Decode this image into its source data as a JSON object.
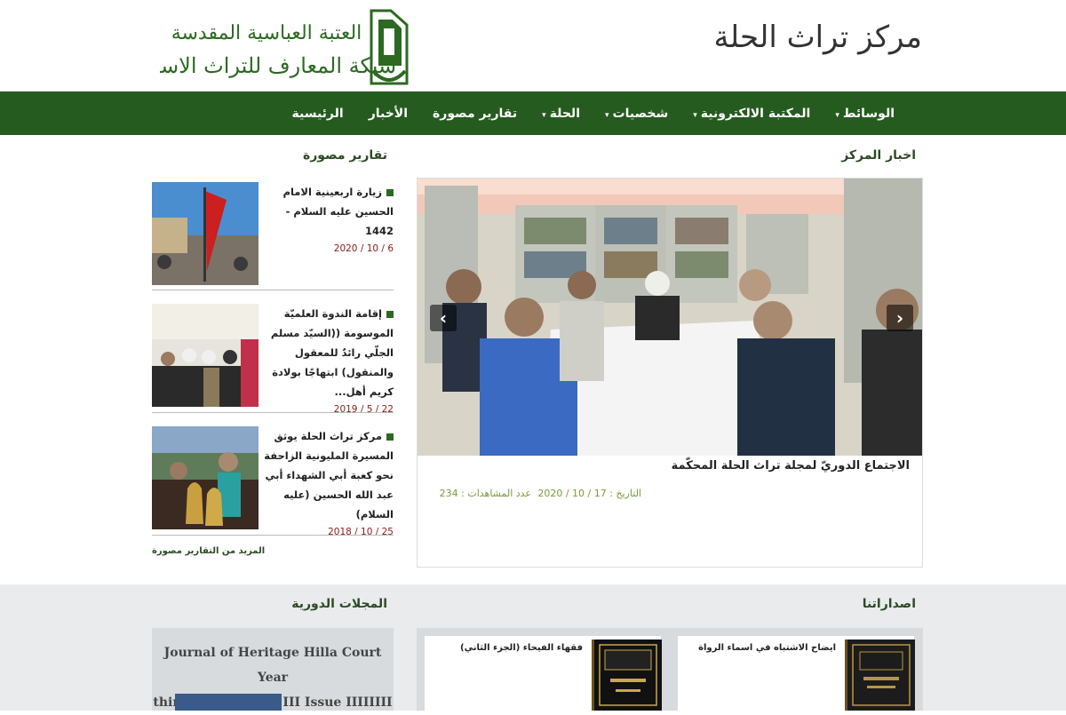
{
  "header": {
    "site_title": "مركز تراث الحلة",
    "logo_line1": "العتبة العباسية المقدسة",
    "logo_line2": "شبكة المعارف للتراث الاسلامي"
  },
  "nav": {
    "items": [
      {
        "label": "الرئيسية",
        "dropdown": false
      },
      {
        "label": "الأخبار",
        "dropdown": false
      },
      {
        "label": "تقارير مصورة",
        "dropdown": false
      },
      {
        "label": "الحلة",
        "dropdown": true
      },
      {
        "label": "شخصيات",
        "dropdown": true
      },
      {
        "label": "المكتبة الالكترونية",
        "dropdown": true
      },
      {
        "label": "الوسائط",
        "dropdown": true
      }
    ]
  },
  "news": {
    "section_title": "اخبار المركز",
    "caption": "الاجتماع الدوريّ لمجلة تراث الحلة المحكّمة",
    "date_label": "التاريخ : 17 / 10 / 2020",
    "views_label": "عدد المشاهدات : 234"
  },
  "reports": {
    "section_title": "تقارير مصورة",
    "items": [
      {
        "title": "زيارة اربعينية الامام الحسين عليه السلام - 1442",
        "date": "6 / 10 / 2020"
      },
      {
        "title": "إقامة الندوة العلميّة الموسومة ((السيّد مسلم الجلّي رائدٌ للمعقول والمنقول) ابتهاجًا بولادة كريم أهل...",
        "date": "22 / 5 / 2019"
      },
      {
        "title": "مركز تراث الحلة يوثق المسيرة المليونية الزاحفة نحو كعبة أبي الشهداء أبي عبد الله الحسين (عليه السلام)",
        "date": "25 / 10 / 2018"
      }
    ],
    "more_label": "المزيد من التقارير مصورة"
  },
  "publications": {
    "section_title": "اصداراتنا",
    "items": [
      {
        "title": "ايضاح الاشتباه في اسماء الرواة"
      },
      {
        "title": "فقهاء الفيحاء (الجزء الثاني)"
      }
    ]
  },
  "journals": {
    "section_title": "المجلات الدورية",
    "line1": "Journal of Heritage Hilla Court Year",
    "line2": "third Year Volume III Issue IIIIIIII"
  },
  "colors": {
    "nav_bg": "#255b1f",
    "accent_green": "#2c6a22",
    "date_red": "#8b1a1a",
    "meta_green": "#7a9a3b"
  }
}
